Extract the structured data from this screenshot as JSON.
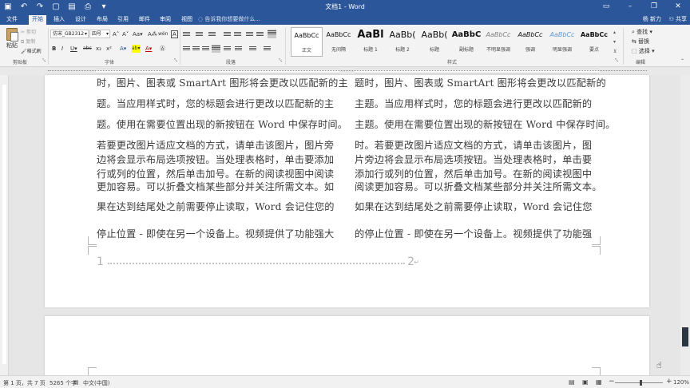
{
  "title_bar": {
    "title": "文档1 - Word",
    "qat": [
      "save-icon",
      "undo-icon",
      "redo-icon",
      "new-doc-icon",
      "open-icon",
      "print-preview-icon",
      "more-icon"
    ],
    "window_controls": [
      "ribbon-display-icon",
      "minimize-icon",
      "restore-icon",
      "close-icon"
    ],
    "qat_glyphs": [
      "▣",
      "↶",
      "↷",
      "▢",
      "▤",
      "⎙",
      "▾"
    ],
    "window_glyphs": [
      "▭",
      "–",
      "❐",
      "✕"
    ]
  },
  "tabs": [
    "文件",
    "开始",
    "插入",
    "设计",
    "布局",
    "引用",
    "邮件",
    "审阅",
    "视图"
  ],
  "active_tab": "开始",
  "tell_me": "告诉我你想要做什么...",
  "user": "杨 新力",
  "share": "共享",
  "ribbon": {
    "clipboard": {
      "label": "剪贴板",
      "paste": "粘贴",
      "cut": "剪切",
      "copy": "复制",
      "format_painter": "格式刷"
    },
    "font": {
      "label": "字体",
      "font_name": "仿宋_GB2312",
      "font_size": "四号",
      "buttons_row1": [
        "A˄",
        "A˅",
        "Aa▾",
        "A⁂",
        "wén",
        "A"
      ],
      "buttons_row2": [
        "B",
        "I",
        "U▾",
        "abc",
        "x₂",
        "x²",
        "A▾",
        "ab▾",
        "A▾",
        "Ⓐ"
      ]
    },
    "paragraph": {
      "label": "段落"
    },
    "styles": {
      "label": "样式",
      "items": [
        {
          "sample": "AaBbCc",
          "name": "正文"
        },
        {
          "sample": "AaBbCc",
          "name": "无间隔"
        },
        {
          "sample": "AaBl",
          "name": "标题 1"
        },
        {
          "sample": "AaBb(",
          "name": "标题 2"
        },
        {
          "sample": "AaBb(",
          "name": "标题"
        },
        {
          "sample": "AaBbC",
          "name": "副标题"
        },
        {
          "sample": "AaBbCc",
          "name": "不明显强调"
        },
        {
          "sample": "AaBbCc",
          "name": "强调"
        },
        {
          "sample": "AaBbCc",
          "name": "明显强调"
        },
        {
          "sample": "AaBbCc",
          "name": "要点"
        }
      ]
    },
    "editing": {
      "label": "编辑",
      "find": "查找",
      "replace": "替换",
      "select": "选择"
    }
  },
  "document": {
    "left_column": [
      "时，图片、图表或 SmartArt 图形将会更改以匹配新的主",
      "题。当应用样式时，您的标题会进行更改以匹配新的主",
      "题。使用在需要位置出现的新按钮在 Word 中保存时间。",
      "若要更改图片适应文档的方式，请单击该图片，图片旁",
      "边将会显示布局选项按钮。当处理表格时，单击要添加",
      "行或列的位置，然后单击加号。在新的阅读视图中阅读",
      "更加容易。可以折叠文档某些部分并关注所需文本。如",
      "果在达到结尾处之前需要停止读取，Word 会记住您的",
      "停止位置 - 即使在另一个设备上。视频提供了功能强大"
    ],
    "right_column": [
      "题时，图片、图表或 SmartArt 图形将会更改以匹配新的",
      "主题。当应用样式时，您的标题会进行更改以匹配新的",
      "主题。使用在需要位置出现的新按钮在 Word 中保存时间。",
      "时。若要更改图片适应文档的方式，请单击该图片，图",
      "片旁边将会显示布局选项按钮。当处理表格时，单击要",
      "添加行或列的位置，然后单击加号。在新的阅读视图中",
      "阅读更加容易。可以折叠文档某些部分并关注所需文本。",
      "如果在达到结尾处之前需要停止读取，Word 会记住您",
      "的停止位置 - 即使在另一个设备上。视频提供了功能强"
    ],
    "toc_start": "1",
    "toc_end": "2",
    "paragraph_mark": "↵"
  },
  "status_bar": {
    "page": "第 1 页，共 7 页",
    "words": "5265 个字",
    "language": "中文(中国)",
    "zoom": "120%",
    "zoom_out": "−",
    "zoom_in": "+",
    "view_icons": [
      "read-mode-icon",
      "print-layout-icon",
      "web-layout-icon"
    ],
    "view_glyphs": [
      "▤",
      "▣",
      "▦"
    ]
  }
}
